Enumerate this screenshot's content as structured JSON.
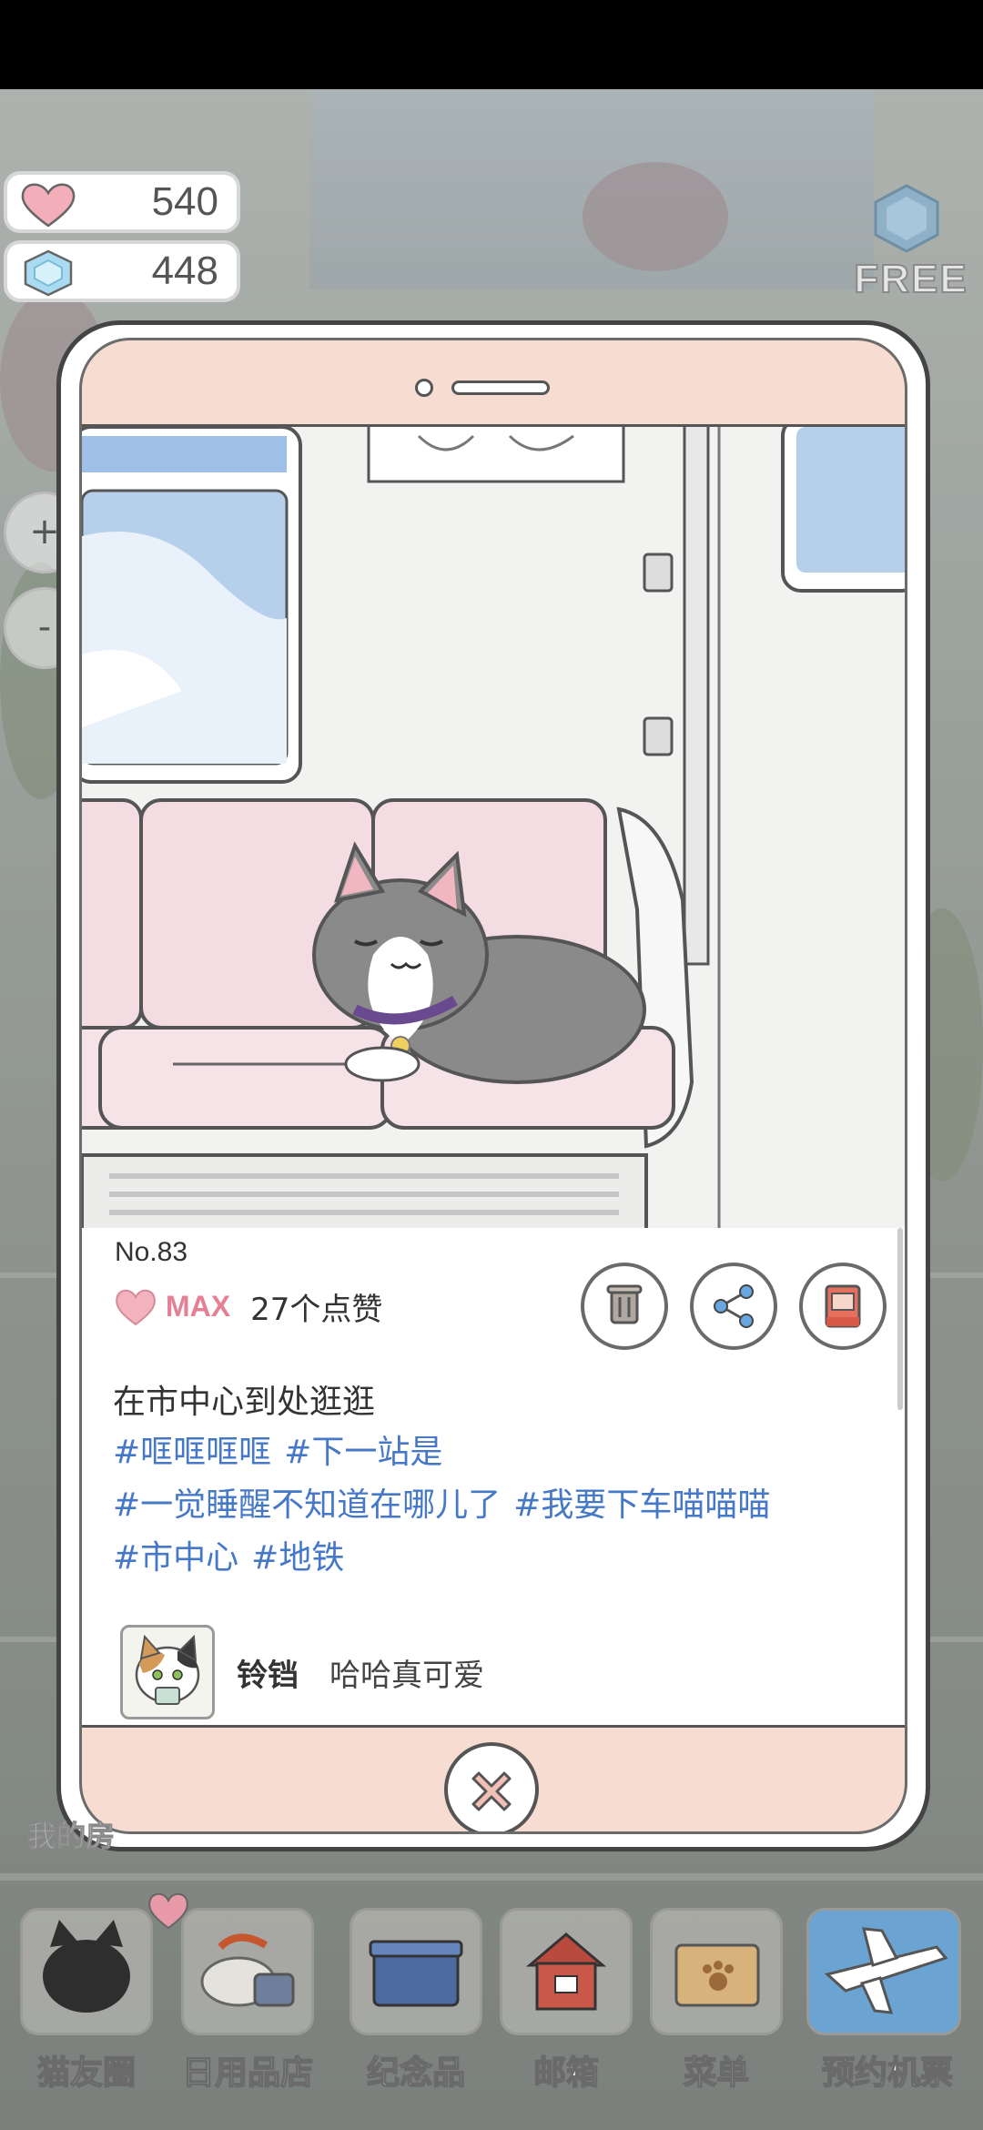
{
  "currency": {
    "hearts": "540",
    "gems": "448",
    "free_label": "FREE"
  },
  "side_buttons": {
    "zoom_in": "+",
    "zoom_out": "-"
  },
  "post": {
    "number": "No.83",
    "likes_badge": "MAX",
    "likes_count": "27个点赞",
    "caption": "在市中心到处逛逛",
    "hashtags": [
      "#哐哐哐哐",
      "#下一站是",
      "#一觉睡醒不知道在哪儿了",
      "#我要下车喵喵喵",
      "#市中心",
      "#地铁"
    ],
    "comment": {
      "author": "铃铛",
      "text": "哈哈真可爱"
    }
  },
  "actions": {
    "delete_icon": "trash-icon",
    "share_icon": "share-icon",
    "album_icon": "album-icon",
    "close_icon": "close-icon"
  },
  "bottom_nav": {
    "my_room": "我的房",
    "items": [
      "猫友圈",
      "日用品店",
      "纪念品",
      "邮箱",
      "菜单",
      "预约机票"
    ]
  },
  "colors": {
    "hashtag": "#4678c8",
    "max_badge": "#e58094",
    "phone_frame": "#f7dcd1",
    "seat_pink": "#f3dde3"
  }
}
